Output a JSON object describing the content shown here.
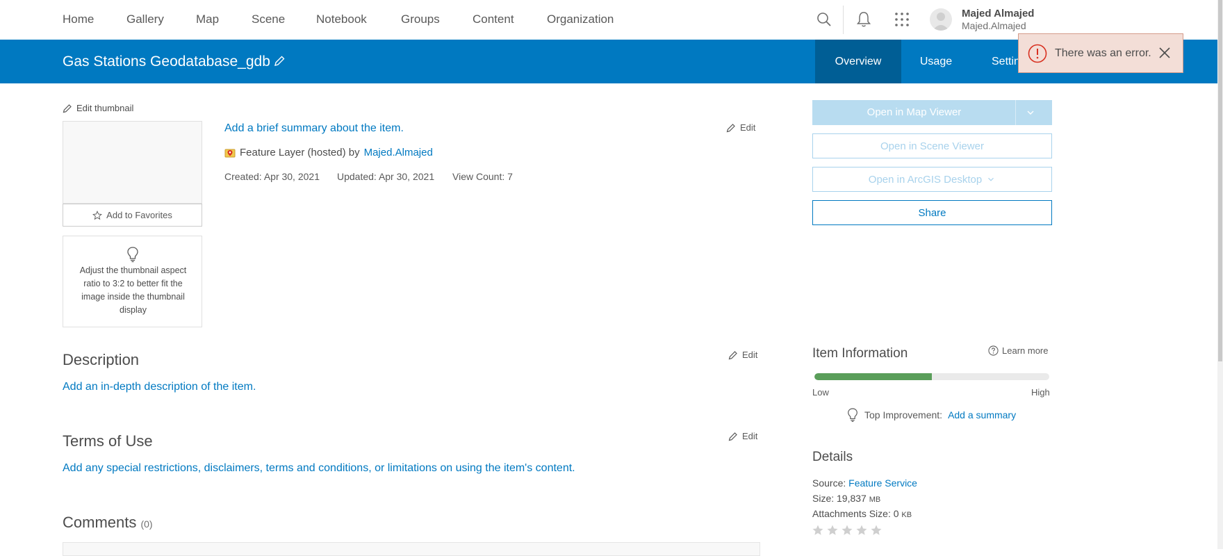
{
  "nav": {
    "items": [
      "Home",
      "Gallery",
      "Map",
      "Scene",
      "Notebook",
      "Groups",
      "Content",
      "Organization"
    ]
  },
  "user": {
    "name": "Majed Almajed",
    "handle": "Majed.Almajed"
  },
  "item": {
    "title": "Gas Stations Geodatabase_gdb",
    "tabs": [
      "Overview",
      "Usage",
      "Settin"
    ],
    "active_tab": "Overview"
  },
  "toast": {
    "message": "There was an error."
  },
  "thumbnail": {
    "edit_label": "Edit thumbnail",
    "favorites_label": "Add to Favorites",
    "tip": "Adjust the thumbnail aspect ratio to 3:2 to better fit the image inside the thumbnail display"
  },
  "summary": {
    "link": "Add a brief summary about the item.",
    "edit": "Edit",
    "type_text": "Feature Layer (hosted) by",
    "owner": "Majed.Almajed",
    "created": "Created: Apr 30, 2021",
    "updated": "Updated: Apr 30, 2021",
    "view_count": "View Count: 7"
  },
  "actions": {
    "open_map_viewer": "Open in Map Viewer",
    "open_scene_viewer": "Open in Scene Viewer",
    "open_desktop": "Open in ArcGIS Desktop",
    "share": "Share"
  },
  "description": {
    "title": "Description",
    "edit": "Edit",
    "link": "Add an in-depth description of the item."
  },
  "terms": {
    "title": "Terms of Use",
    "edit": "Edit",
    "link": "Add any special restrictions, disclaimers, terms and conditions, or limitations on using the item's content."
  },
  "comments": {
    "title": "Comments",
    "count": "(0)"
  },
  "item_information": {
    "title": "Item Information",
    "learn_more": "Learn more",
    "low": "Low",
    "high": "High",
    "score": 0.5,
    "top_improvement_label": "Top Improvement:",
    "top_improvement_link": "Add a summary"
  },
  "details": {
    "title": "Details",
    "source_label": "Source:",
    "source_value": "Feature Service",
    "size_label": "Size: 19,837",
    "size_unit": "MB",
    "attachments_label": "Attachments Size: 0",
    "attachments_unit": "KB",
    "rating": 0
  },
  "colors": {
    "brand_blue": "#0079c1",
    "active_tab": "#005e95",
    "error_bg": "#f3ded7",
    "error_icon": "#d83020",
    "quality_fill": "#5a9e5a"
  }
}
